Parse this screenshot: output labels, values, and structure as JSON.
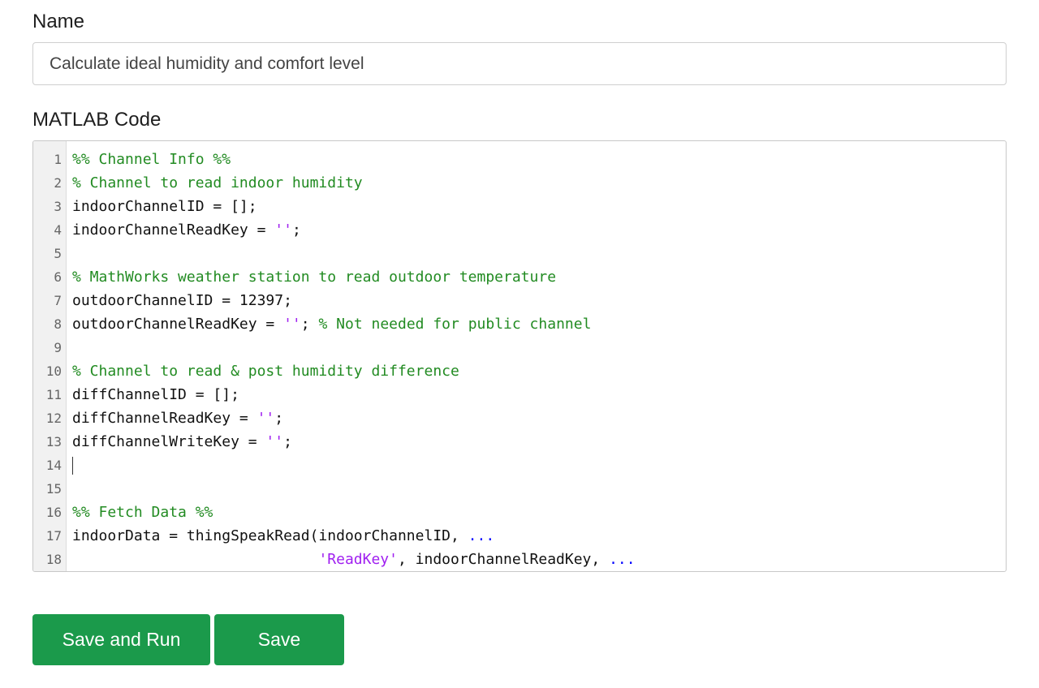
{
  "form": {
    "name_label": "Name",
    "name_value": "Calculate ideal humidity and comfort level",
    "code_label": "MATLAB Code"
  },
  "editor": {
    "lines": [
      {
        "number": "1",
        "tokens": [
          {
            "type": "comment",
            "text": "%% Channel Info %%"
          }
        ]
      },
      {
        "number": "2",
        "tokens": [
          {
            "type": "comment",
            "text": "% Channel to read indoor humidity"
          }
        ]
      },
      {
        "number": "3",
        "tokens": [
          {
            "type": "plain",
            "text": "indoorChannelID = [];"
          }
        ]
      },
      {
        "number": "4",
        "tokens": [
          {
            "type": "plain",
            "text": "indoorChannelReadKey = "
          },
          {
            "type": "string",
            "text": "''"
          },
          {
            "type": "plain",
            "text": ";"
          }
        ]
      },
      {
        "number": "5",
        "tokens": []
      },
      {
        "number": "6",
        "tokens": [
          {
            "type": "comment",
            "text": "% MathWorks weather station to read outdoor temperature"
          }
        ]
      },
      {
        "number": "7",
        "tokens": [
          {
            "type": "plain",
            "text": "outdoorChannelID = 12397;"
          }
        ]
      },
      {
        "number": "8",
        "tokens": [
          {
            "type": "plain",
            "text": "outdoorChannelReadKey = "
          },
          {
            "type": "string",
            "text": "''"
          },
          {
            "type": "plain",
            "text": "; "
          },
          {
            "type": "comment",
            "text": "% Not needed for public channel"
          }
        ]
      },
      {
        "number": "9",
        "tokens": []
      },
      {
        "number": "10",
        "tokens": [
          {
            "type": "comment",
            "text": "% Channel to read & post humidity difference"
          }
        ]
      },
      {
        "number": "11",
        "tokens": [
          {
            "type": "plain",
            "text": "diffChannelID = [];"
          }
        ]
      },
      {
        "number": "12",
        "tokens": [
          {
            "type": "plain",
            "text": "diffChannelReadKey = "
          },
          {
            "type": "string",
            "text": "''"
          },
          {
            "type": "plain",
            "text": ";"
          }
        ]
      },
      {
        "number": "13",
        "tokens": [
          {
            "type": "plain",
            "text": "diffChannelWriteKey = "
          },
          {
            "type": "string",
            "text": "''"
          },
          {
            "type": "plain",
            "text": ";"
          }
        ]
      },
      {
        "number": "14",
        "tokens": [],
        "cursor": true
      },
      {
        "number": "15",
        "tokens": []
      },
      {
        "number": "16",
        "tokens": [
          {
            "type": "comment",
            "text": "%% Fetch Data %%"
          }
        ]
      },
      {
        "number": "17",
        "tokens": [
          {
            "type": "plain",
            "text": "indoorData = thingSpeakRead(indoorChannelID, "
          },
          {
            "type": "continuation",
            "text": "..."
          }
        ]
      },
      {
        "number": "18",
        "tokens": [
          {
            "type": "plain",
            "text": "                            "
          },
          {
            "type": "string",
            "text": "'ReadKey'"
          },
          {
            "type": "plain",
            "text": ", indoorChannelReadKey, "
          },
          {
            "type": "continuation",
            "text": "..."
          }
        ]
      }
    ]
  },
  "actions": {
    "save_and_run_label": "Save and Run",
    "save_label": "Save"
  },
  "colors": {
    "comment": "#228b22",
    "string": "#a020f0",
    "continuation": "#0000ff",
    "button_bg": "#1b9a4b"
  }
}
